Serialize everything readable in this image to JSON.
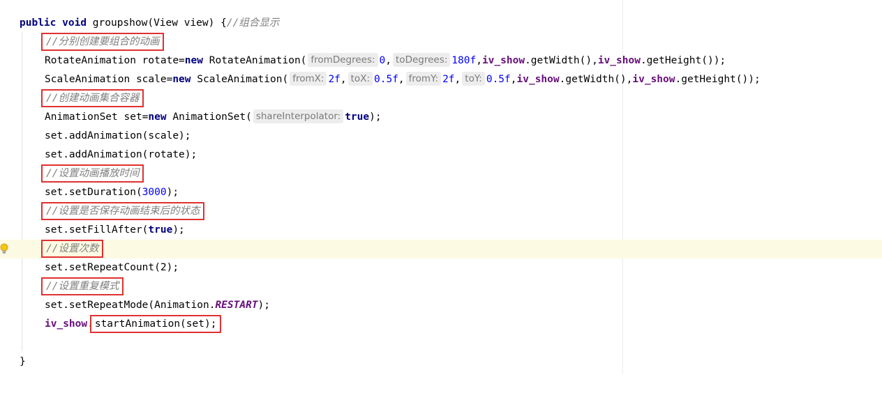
{
  "editor": {
    "line1": {
      "kw_public": "public",
      "kw_void": "void",
      "method_sig": " groupshow(View view) {",
      "comment": "//组合显示"
    },
    "line2": {
      "comment": "//分别创建要组合的动画"
    },
    "line3": {
      "decl": "RotateAnimation rotate=",
      "kw_new": "new",
      "ctor": " RotateAnimation(",
      "hint1": "fromDegrees:",
      "val1": "0",
      "sep1": ",",
      "hint2": "toDegrees:",
      "val2": "180f",
      "sep2": ",",
      "field1": "iv_show",
      "call1": ".getWidth(),",
      "field2": "iv_show",
      "call2": ".getHeight());"
    },
    "line4": {
      "decl": "ScaleAnimation scale=",
      "kw_new": "new",
      "ctor": " ScaleAnimation(",
      "hint1": "fromX:",
      "val1": "2f",
      "sep1": ",",
      "hint2": "toX:",
      "val2": "0.5f",
      "sep2": ",",
      "hint3": "fromY:",
      "val3": "2f",
      "sep3": ",",
      "hint4": "toY:",
      "val4": "0.5f",
      "sep4": ",",
      "field1": "iv_show",
      "call1": ".getWidth(),",
      "field2": "iv_show",
      "call2": ".getHeight());"
    },
    "line5": {
      "comment": "//创建动画集合容器"
    },
    "line6": {
      "decl": "AnimationSet set=",
      "kw_new": "new",
      "ctor": " AnimationSet(",
      "hint1": "shareInterpolator:",
      "kw_true": "true",
      "tail": ");"
    },
    "line7": {
      "code": "set.addAnimation(scale);"
    },
    "line8": {
      "code": "set.addAnimation(rotate);"
    },
    "line9": {
      "comment": "//设置动画播放时间"
    },
    "line10": {
      "pre": "set.setDuration(",
      "num": "3000",
      "post": ");"
    },
    "line11": {
      "comment": "//设置是否保存动画结束后的状态"
    },
    "line12": {
      "pre": "set.setFillAfter(",
      "kw_true": "true",
      "post": ");"
    },
    "line13": {
      "comment": "//设置次数"
    },
    "line14": {
      "code": "set.setRepeatCount(2);"
    },
    "line15": {
      "comment": "//设置重复模式"
    },
    "line16": {
      "pre": "set.setRepeatMode(Animation.",
      "const": "RESTART",
      "post": ");"
    },
    "line17": {
      "field": "iv_show",
      "dot": ".",
      "boxed": "startAnimation(set);"
    },
    "line19": {
      "code": "}"
    }
  },
  "colors": {
    "keyword": "#000080",
    "comment": "#808080",
    "number": "#0000ff",
    "field": "#660e7a",
    "highlight_box": "#e03030",
    "current_line": "#fcfae2"
  },
  "icons": {
    "gutter": "lightbulb-icon"
  }
}
